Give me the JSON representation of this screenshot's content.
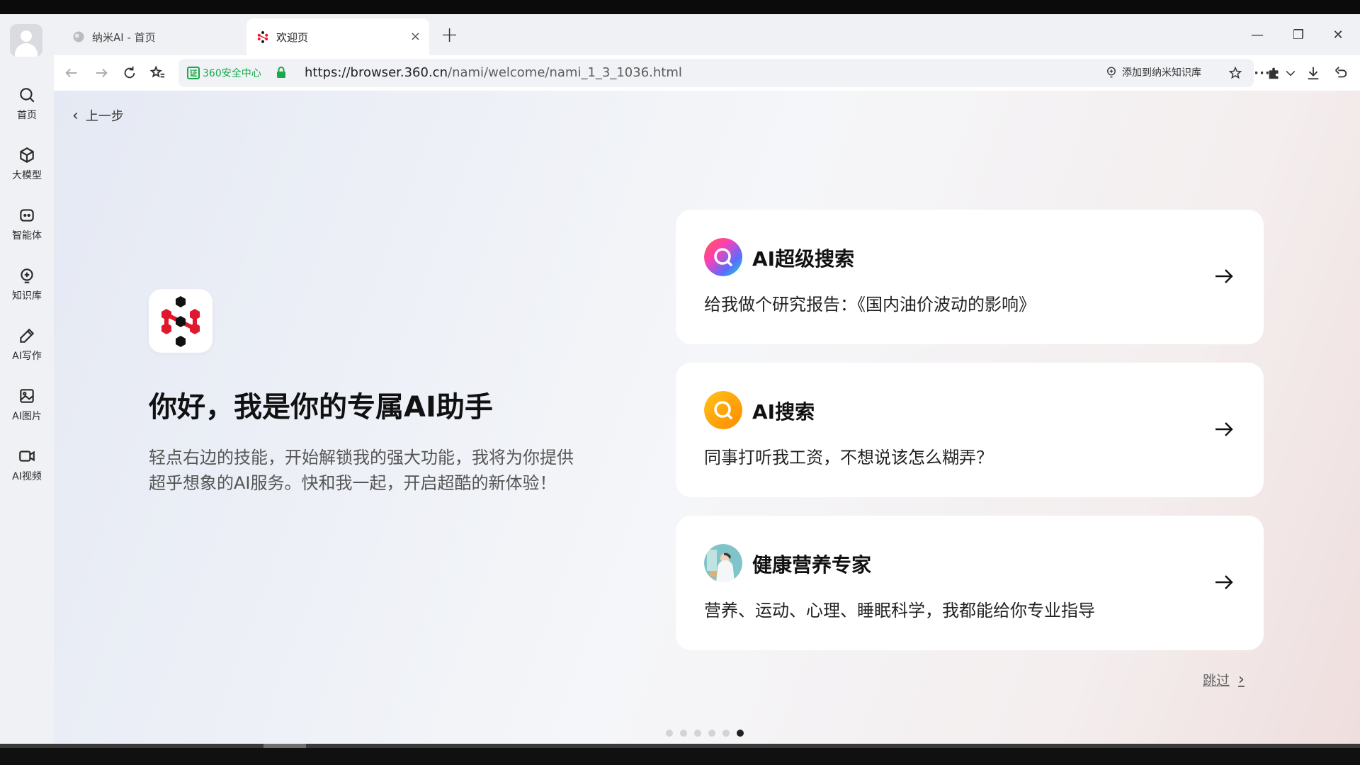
{
  "tabs": [
    {
      "label": "纳米AI - 首页"
    },
    {
      "label": "欢迎页",
      "close": "×"
    }
  ],
  "new_tab": "+",
  "window_controls": {
    "minimize": "—",
    "restore": "❐",
    "close": "✕"
  },
  "rail": [
    {
      "label": "首页",
      "icon": "search-icon"
    },
    {
      "label": "大模型",
      "icon": "cube-icon"
    },
    {
      "label": "智能体",
      "icon": "agent-icon"
    },
    {
      "label": "知识库",
      "icon": "bulb-icon"
    },
    {
      "label": "AI写作",
      "icon": "pen-icon"
    },
    {
      "label": "AI图片",
      "icon": "image-icon"
    },
    {
      "label": "AI视频",
      "icon": "video-icon"
    }
  ],
  "address": {
    "security_label": "360安全中心",
    "security_mark": "证",
    "url_host": "https://browser.360.cn",
    "url_path": "/nami/welcome/nami_1_3_1036.html",
    "add_to_kb": "添加到纳米知识库",
    "more": "···"
  },
  "content": {
    "back_label": "上一步",
    "back_chevron": "‹",
    "hero_title": "你好，我是你的专属AI助手",
    "hero_desc": "轻点右边的技能，开始解锁我的强大功能，我将为你提供超乎想象的AI服务。快和我一起，开启超酷的新体验！",
    "cards": [
      {
        "title": "AI超级搜索",
        "subtitle": "给我做个研究报告：《国内油价波动的影响》"
      },
      {
        "title": "AI搜索",
        "subtitle": "同事打听我工资，不想说该怎么糊弄？"
      },
      {
        "title": "健康营养专家",
        "subtitle": "营养、运动、心理、睡眠科学，我都能给你专业指导"
      }
    ],
    "skip_label": "跳过",
    "skip_chevron": "›",
    "pager": {
      "count": 6,
      "active": 6
    }
  },
  "colors": {
    "secure_green": "#19a84a",
    "brand_red": "#e0182d"
  }
}
